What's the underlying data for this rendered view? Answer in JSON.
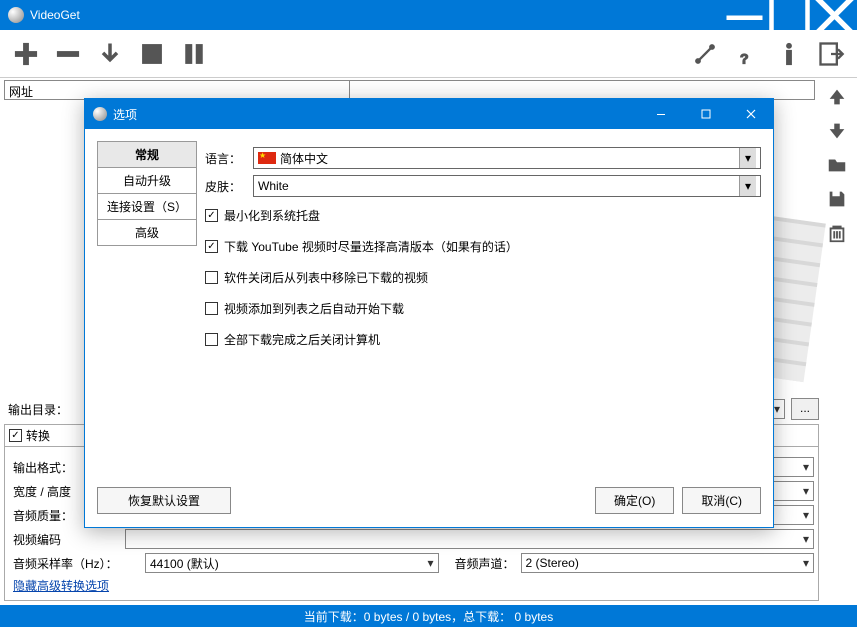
{
  "window": {
    "title": "VideoGet"
  },
  "url_table": {
    "col_url": "网址"
  },
  "form": {
    "output_dir_label": "输出目录：",
    "convert_label": "转换",
    "output_format_label": "输出格式：",
    "width_height_label": "宽度 / 高度",
    "audio_quality_label": "音频质量：",
    "video_codec_label": "视频编码",
    "sample_rate_label": "音频采样率（Hz）：",
    "sample_rate_value": "44100 (默认)",
    "audio_channel_label": "音频声道：",
    "audio_channel_value": "2 (Stereo)",
    "hide_adv_link": "隐藏高级转换选项"
  },
  "dialog": {
    "title": "选项",
    "tabs": {
      "general": "常规",
      "autoupdate": "自动升级",
      "connection": "连接设置（S）",
      "advanced": "高级"
    },
    "general": {
      "lang_label": "语言：",
      "lang_value": "简体中文",
      "skin_label": "皮肤：",
      "skin_value": "White",
      "chk_tray": "最小化到系统托盘",
      "chk_hd": "下载 YouTube 视频时尽量选择高清版本（如果有的话）",
      "chk_remove": "软件关闭后从列表中移除已下载的视频",
      "chk_autostart": "视频添加到列表之后自动开始下载",
      "chk_shutdown": "全部下载完成之后关闭计算机"
    },
    "buttons": {
      "restore": "恢复默认设置",
      "ok": "确定(O)",
      "cancel": "取消(C)"
    }
  },
  "status": {
    "text": "当前下载：0 bytes / 0 bytes，总下载： 0 bytes"
  }
}
